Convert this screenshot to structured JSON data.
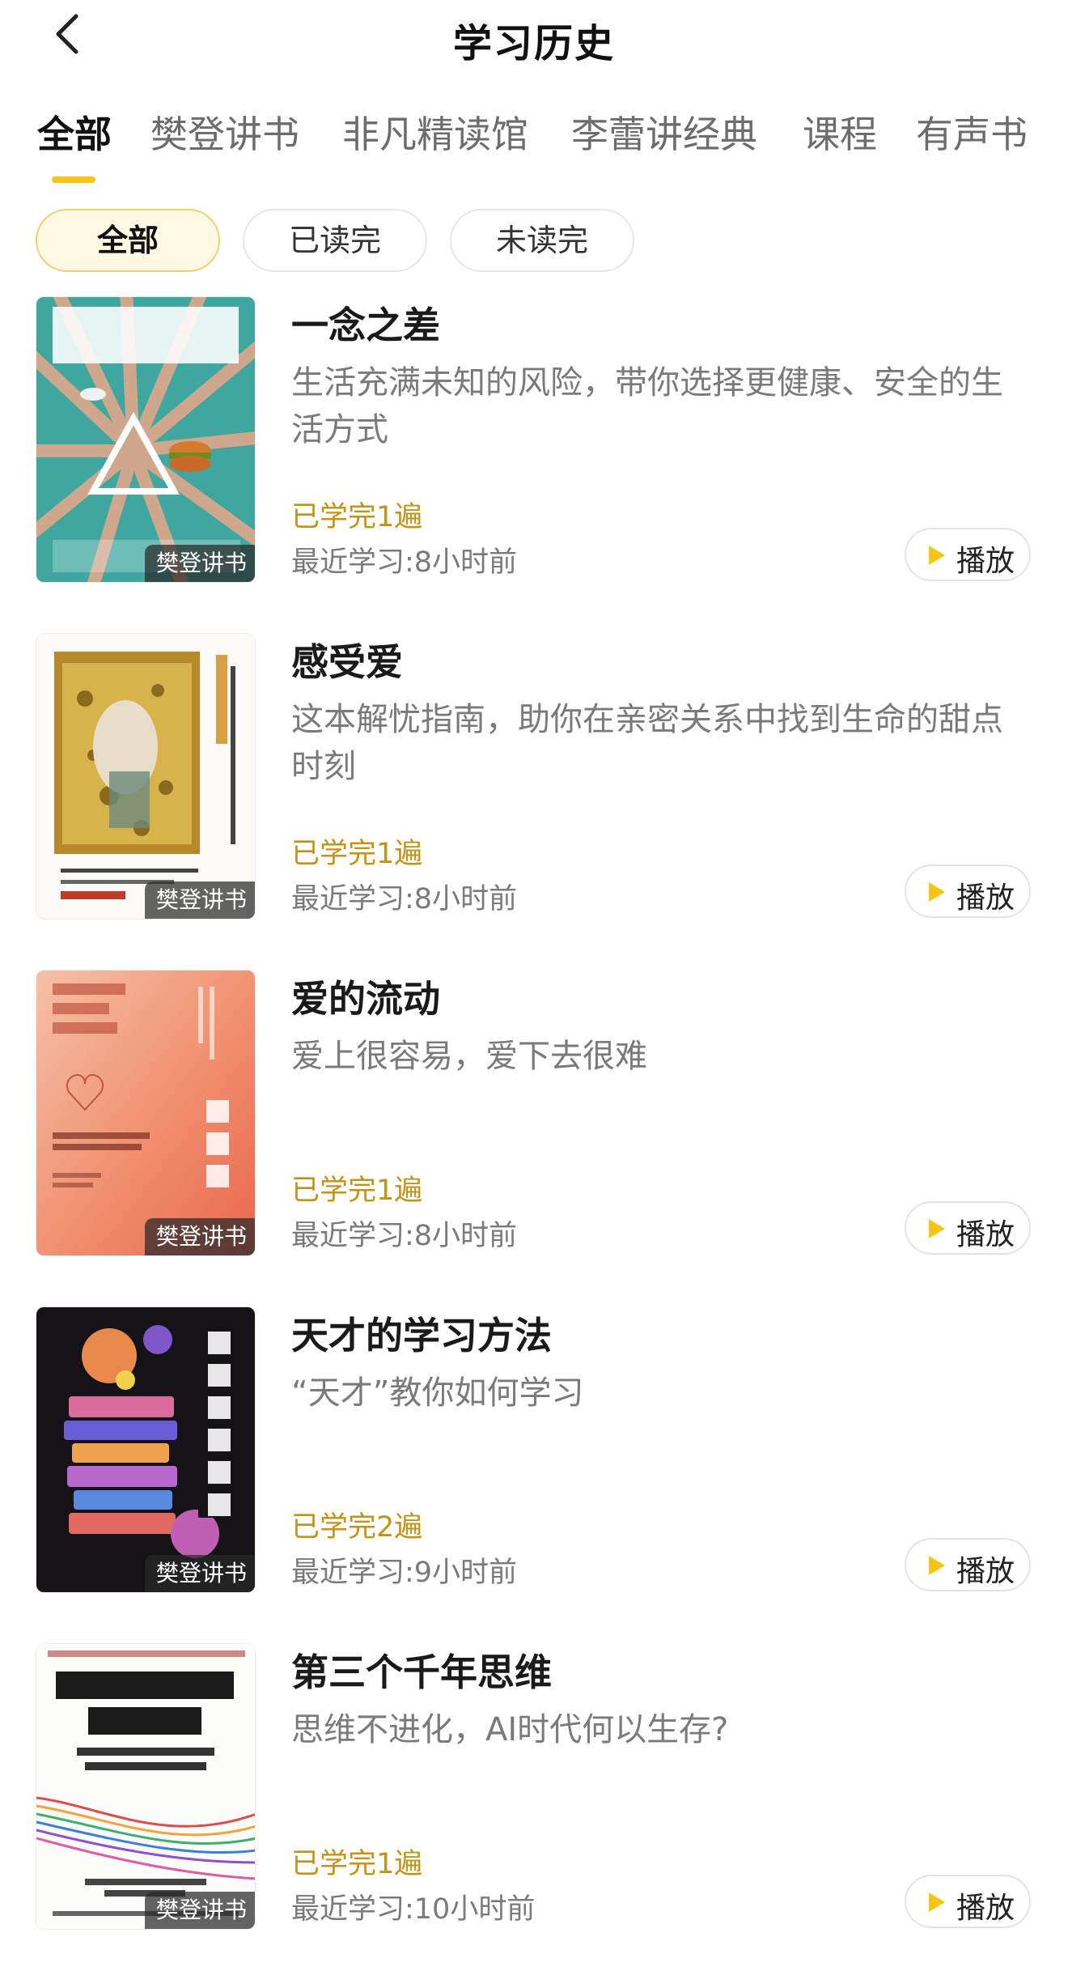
{
  "header": {
    "title": "学习历史",
    "back_icon": "chevron-left-icon"
  },
  "tabs": [
    {
      "label": "全部",
      "active": true
    },
    {
      "label": "樊登讲书",
      "active": false
    },
    {
      "label": "非凡精读馆",
      "active": false
    },
    {
      "label": "李蕾讲经典",
      "active": false
    },
    {
      "label": "课程",
      "active": false
    },
    {
      "label": "有声书",
      "active": false
    }
  ],
  "filters": [
    {
      "label": "全部",
      "active": true
    },
    {
      "label": "已读完",
      "active": false
    },
    {
      "label": "未读完",
      "active": false
    }
  ],
  "colors": {
    "accent": "#f5c518",
    "progress_text": "#c69213",
    "muted_text": "#7a7a7a"
  },
  "items": [
    {
      "title": "一念之差",
      "description": "生活充满未知的风险，带你选择更健康、安全的生活方式",
      "badge": "樊登讲书",
      "progress": "已学完1遍",
      "recent": "最近学习:8小时前",
      "play_label": "播放"
    },
    {
      "title": "感受爱",
      "description": "这本解忧指南，助你在亲密关系中找到生命的甜点时刻",
      "badge": "樊登讲书",
      "progress": "已学完1遍",
      "recent": "最近学习:8小时前",
      "play_label": "播放"
    },
    {
      "title": "爱的流动",
      "description": "爱上很容易，爱下去很难",
      "badge": "樊登讲书",
      "progress": "已学完1遍",
      "recent": "最近学习:8小时前",
      "play_label": "播放"
    },
    {
      "title": "天才的学习方法",
      "description": "“天才”教你如何学习",
      "badge": "樊登讲书",
      "progress": "已学完2遍",
      "recent": "最近学习:9小时前",
      "play_label": "播放"
    },
    {
      "title": "第三个千年思维",
      "description": "思维不进化，AI时代何以生存?",
      "badge": "樊登讲书",
      "progress": "已学完1遍",
      "recent": "最近学习:10小时前",
      "play_label": "播放"
    }
  ]
}
